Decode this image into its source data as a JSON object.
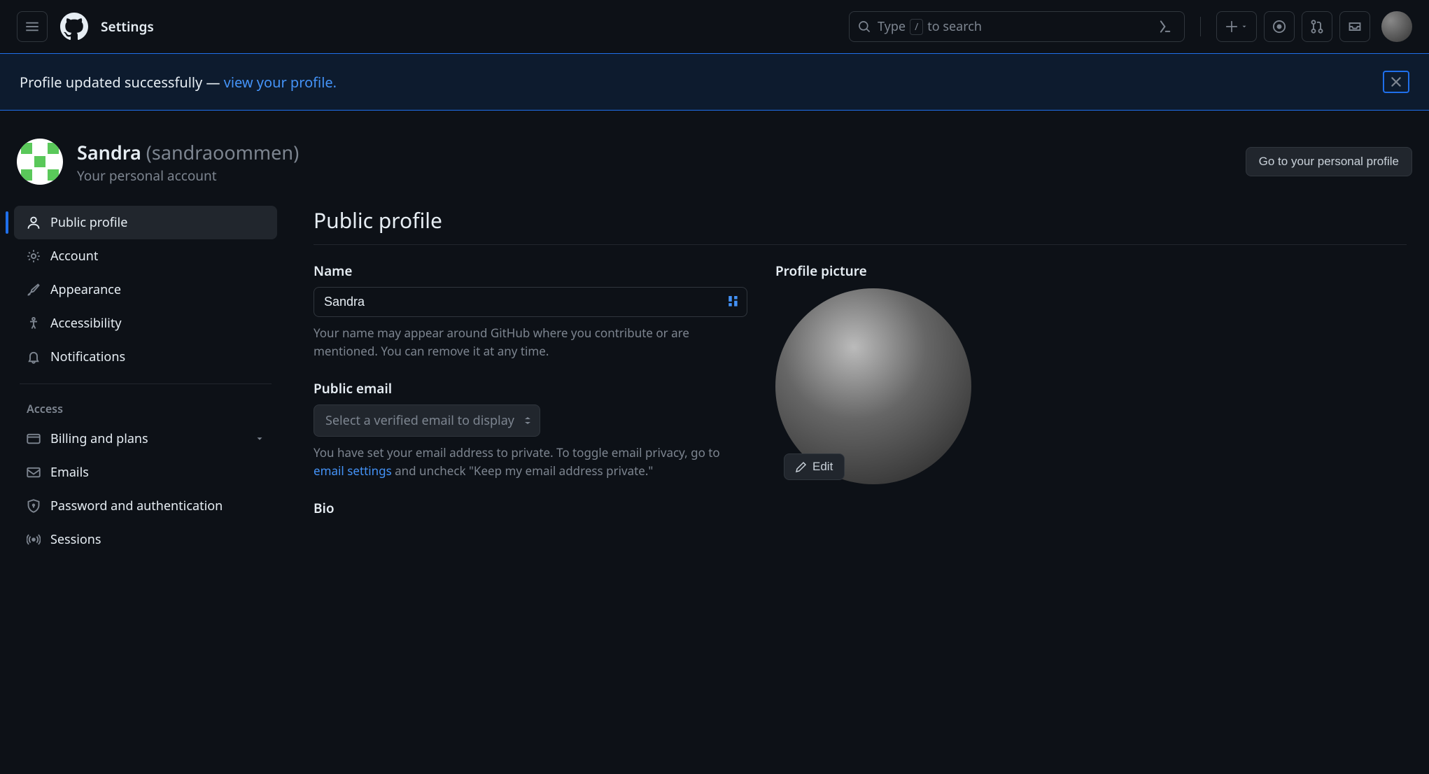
{
  "header": {
    "title": "Settings",
    "search_placeholder_pre": "Type",
    "search_slash": "/",
    "search_placeholder_post": "to search"
  },
  "flash": {
    "text_pre": "Profile updated successfully — ",
    "link": "view your profile."
  },
  "account": {
    "display_name": "Sandra",
    "username": "(sandraoommen)",
    "subtitle": "Your personal account",
    "go_profile": "Go to your personal profile"
  },
  "sidebar": {
    "items": [
      {
        "label": "Public profile"
      },
      {
        "label": "Account"
      },
      {
        "label": "Appearance"
      },
      {
        "label": "Accessibility"
      },
      {
        "label": "Notifications"
      }
    ],
    "access_heading": "Access",
    "access_items": [
      {
        "label": "Billing and plans"
      },
      {
        "label": "Emails"
      },
      {
        "label": "Password and authentication"
      },
      {
        "label": "Sessions"
      }
    ]
  },
  "main": {
    "section_title": "Public profile",
    "name_label": "Name",
    "name_value": "Sandra",
    "name_help": "Your name may appear around GitHub where you contribute or are mentioned. You can remove it at any time.",
    "email_label": "Public email",
    "email_placeholder": "Select a verified email to display",
    "email_help_pre": "You have set your email address to private. To toggle email privacy, go to ",
    "email_help_link": "email settings",
    "email_help_post": " and uncheck \"Keep my email address private.\"",
    "bio_label": "Bio",
    "pfp_label": "Profile picture",
    "edit_label": "Edit"
  }
}
